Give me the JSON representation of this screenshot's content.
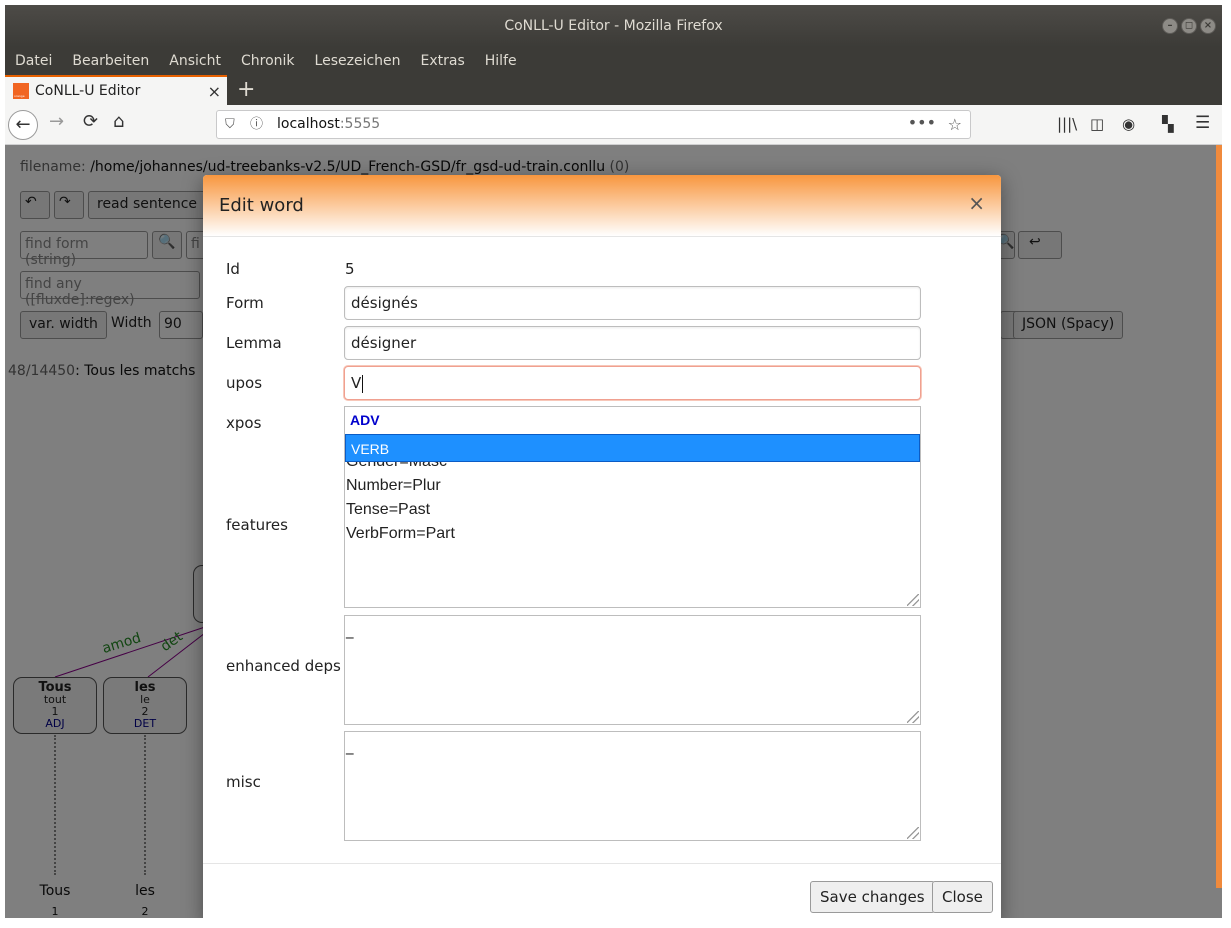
{
  "window": {
    "title": "CoNLL-U Editor - Mozilla Firefox",
    "controls": [
      "–",
      "◻",
      "×"
    ]
  },
  "menu": [
    "Datei",
    "Bearbeiten",
    "Ansicht",
    "Chronik",
    "Lesezeichen",
    "Extras",
    "Hilfe"
  ],
  "tab": {
    "title": "CoNLL-U Editor",
    "close": "×",
    "new_tab": "+"
  },
  "nav": {
    "url_host": "localhost",
    "url_port": ":5555"
  },
  "page": {
    "filename_label": "filename:",
    "filename_path": "/home/johannes/ud-treebanks-v2.5/UD_French-GSD/fr_gsd-ud-train.conllu",
    "filename_suffix": "(0)",
    "read_sentence": "read sentence",
    "find_form_placeholder": "find form (string)",
    "find_second_placeholder": "fi",
    "find_any_placeholder": "find any ([fluxde]:regex)",
    "var_width": "var. width",
    "width_label": "Width",
    "width_value": "90",
    "json_spacy": "JSON (Spacy)",
    "counter_current": "48",
    "counter_total": "/14450",
    "counter_text": ": Tous les matchs"
  },
  "tree": {
    "relations": [
      "amod",
      "det"
    ],
    "nodes": [
      {
        "form": "Tous",
        "lemma": "tout",
        "id": "1",
        "upos": "ADJ"
      },
      {
        "form": "les",
        "lemma": "le",
        "id": "2",
        "upos": "DET"
      }
    ]
  },
  "modal": {
    "title": "Edit word",
    "close": "×",
    "labels": {
      "id": "Id",
      "form": "Form",
      "lemma": "Lemma",
      "upos": "upos",
      "xpos": "xpos",
      "features": "features",
      "enhanced_deps": "enhanced deps",
      "misc": "misc"
    },
    "values": {
      "id": "5",
      "form": "désignés",
      "lemma": "désigner",
      "upos": "V",
      "features_partial": "Gender=Masc",
      "features": [
        "Number=Plur",
        "Tense=Past",
        "VerbForm=Part"
      ],
      "enhanced_deps": "_",
      "misc": "_"
    },
    "autocomplete": [
      "ADV",
      "VERB"
    ],
    "save": "Save changes",
    "close_button": "Close"
  }
}
